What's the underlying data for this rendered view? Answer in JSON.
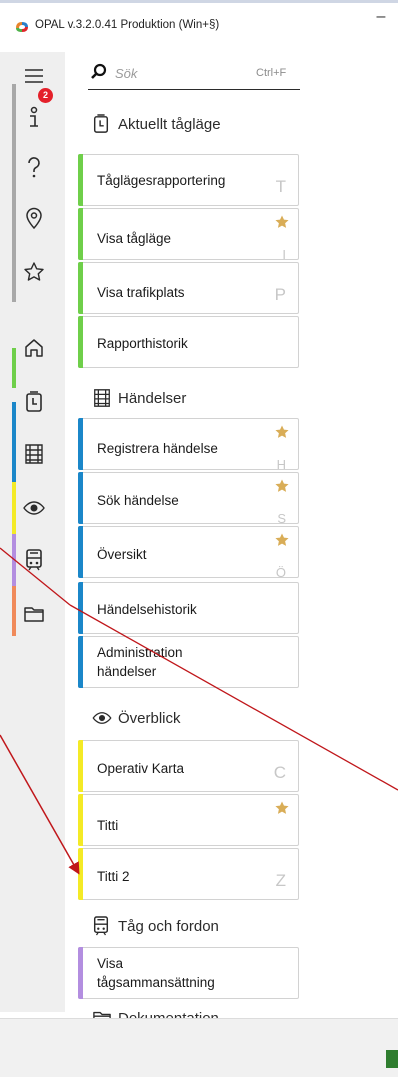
{
  "window": {
    "title": "OPAL v.3.2.0.41 Produktion (Win+§)",
    "minimize": "–"
  },
  "rail": {
    "badge_count": "2",
    "icons": [
      "menu-icon",
      "info-icon",
      "help-icon",
      "location-pin-icon",
      "star-outline-icon",
      "home-icon",
      "clock-train-icon",
      "rail-track-icon",
      "eye-icon",
      "train-icon",
      "folder-icon"
    ]
  },
  "search": {
    "placeholder": "Sök",
    "shortcut": "Ctrl+F"
  },
  "colors": {
    "green": "#6fcf4a",
    "blue": "#1b87c9",
    "yellow": "#f4ea26",
    "purple": "#b38ee0",
    "orange": "#f08a5a",
    "gray": "#a8a8a8",
    "badge": "#e4202a",
    "star": "#d9ad57",
    "annotation": "#c0171b"
  },
  "sections": [
    {
      "title": "Aktuellt tågläge",
      "icon": "clock-train-icon"
    },
    {
      "title": "Händelser",
      "icon": "rail-track-icon"
    },
    {
      "title": "Överblick",
      "icon": "eye-icon"
    },
    {
      "title": "Tåg och fordon",
      "icon": "train-icon"
    },
    {
      "title": "Dokumentation",
      "icon": "folder-icon"
    }
  ],
  "tiles": [
    {
      "label": "Tåglägesrapportering",
      "shortcut": "T",
      "starred": false
    },
    {
      "label": "Visa tågläge",
      "shortcut": "I",
      "starred": true
    },
    {
      "label": "Visa trafikplats",
      "shortcut": "P",
      "starred": false
    },
    {
      "label": "Rapporthistorik",
      "shortcut": "",
      "starred": false
    },
    {
      "label": "Registrera händelse",
      "shortcut": "H",
      "starred": true
    },
    {
      "label": "Sök händelse",
      "shortcut": "S",
      "starred": true
    },
    {
      "label": "Översikt",
      "shortcut": "Ö",
      "starred": true
    },
    {
      "label": "Händelsehistorik",
      "shortcut": "",
      "starred": false
    },
    {
      "label": "Administration händelser",
      "shortcut": "",
      "starred": false
    },
    {
      "label": "Operativ Karta",
      "shortcut": "C",
      "starred": false
    },
    {
      "label": "Titti",
      "shortcut": "",
      "starred": true
    },
    {
      "label": "Titti 2",
      "shortcut": "Z",
      "starred": false
    },
    {
      "label": "Visa tågsammansättning",
      "shortcut": "",
      "starred": false
    }
  ]
}
